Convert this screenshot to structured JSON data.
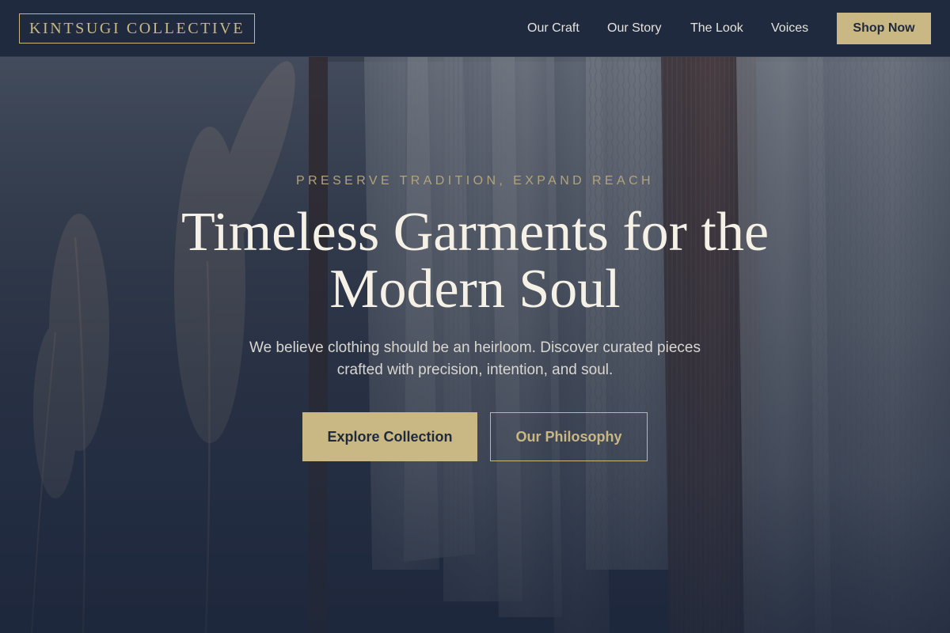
{
  "brand": {
    "logo_text": "KINTSUGI COLLECTIVE"
  },
  "nav": {
    "links": [
      {
        "label": "Our Craft"
      },
      {
        "label": "Our Story"
      },
      {
        "label": "The Look"
      },
      {
        "label": "Voices"
      }
    ],
    "cta_label": "Shop Now"
  },
  "hero": {
    "eyebrow": "PRESERVE TRADITION, EXPAND REACH",
    "headline_line1": "Timeless Garments for the",
    "headline_line2": "Modern Soul",
    "subtext_line1": "We believe clothing should be an heirloom. Discover curated pieces",
    "subtext_line2": "crafted with precision, intention, and soul.",
    "primary_button": "Explore Collection",
    "secondary_button": "Our Philosophy"
  },
  "colors": {
    "navy": "#1f2a3e",
    "gold": "#c9b784",
    "cream": "#f6f1e6",
    "hero_text": "#d9d6cf"
  },
  "background": {
    "subject": "knitwear on hanging rack with pampas grass"
  }
}
